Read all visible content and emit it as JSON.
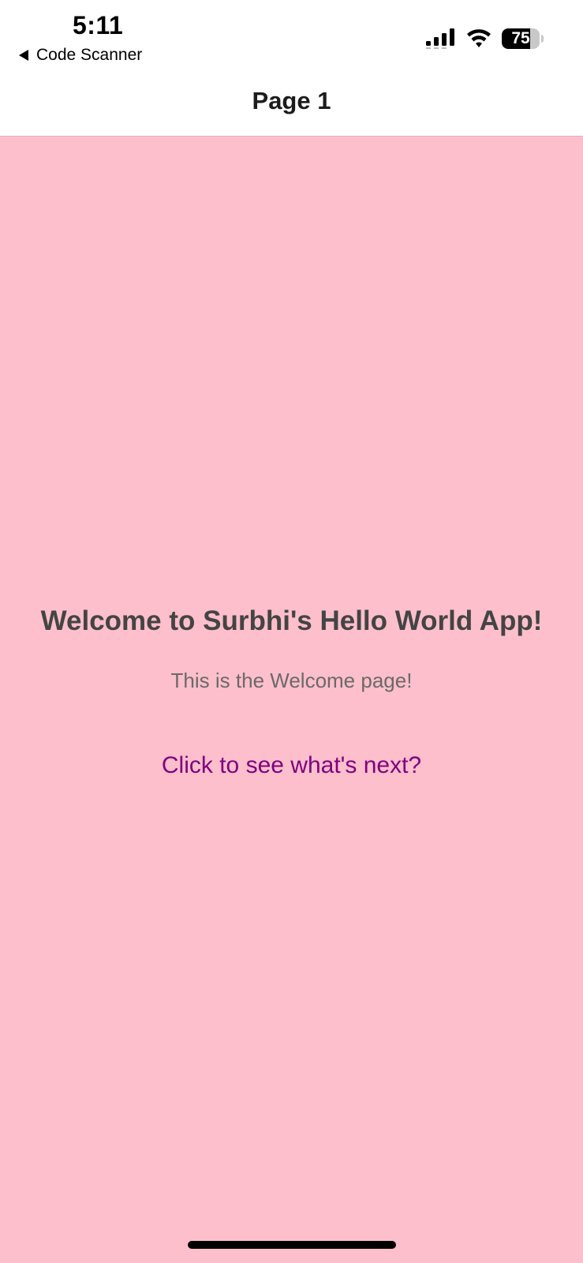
{
  "status_bar": {
    "time": "5:11",
    "back_app_label": "Code Scanner",
    "battery_level": "75",
    "battery_fraction": 0.75
  },
  "nav": {
    "title": "Page 1"
  },
  "main": {
    "heading": "Welcome to Surbhi's Hello World App!",
    "subtitle": "This is the Welcome page!",
    "link_label": "Click to see what's next?"
  },
  "colors": {
    "background": "#fdbfcb",
    "heading": "#444444",
    "subtitle": "#6a6a6a",
    "link": "#800080"
  },
  "icons": {
    "back": "back-triangle-icon",
    "signal": "cellular-signal-icon",
    "wifi": "wifi-icon",
    "battery": "battery-icon"
  }
}
